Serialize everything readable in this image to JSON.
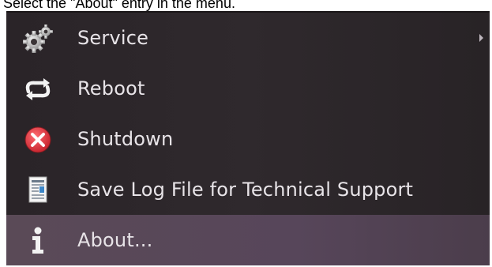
{
  "instruction": "Select the \"About\" entry in the menu.",
  "menu": {
    "items": [
      {
        "label": "Service",
        "icon": "gears-icon",
        "has_submenu": true
      },
      {
        "label": "Reboot",
        "icon": "refresh-arrows-icon",
        "has_submenu": false
      },
      {
        "label": "Shutdown",
        "icon": "close-circle-icon",
        "has_submenu": false
      },
      {
        "label": "Save Log File for Technical Support",
        "icon": "document-icon",
        "has_submenu": false
      },
      {
        "label": "About...",
        "icon": "info-icon",
        "has_submenu": false,
        "selected": true
      }
    ]
  },
  "colors": {
    "menu_background": "#2c2629",
    "selected_background": "#57465a",
    "text": "#e8e4e8",
    "shutdown_icon": "#e0323c"
  }
}
